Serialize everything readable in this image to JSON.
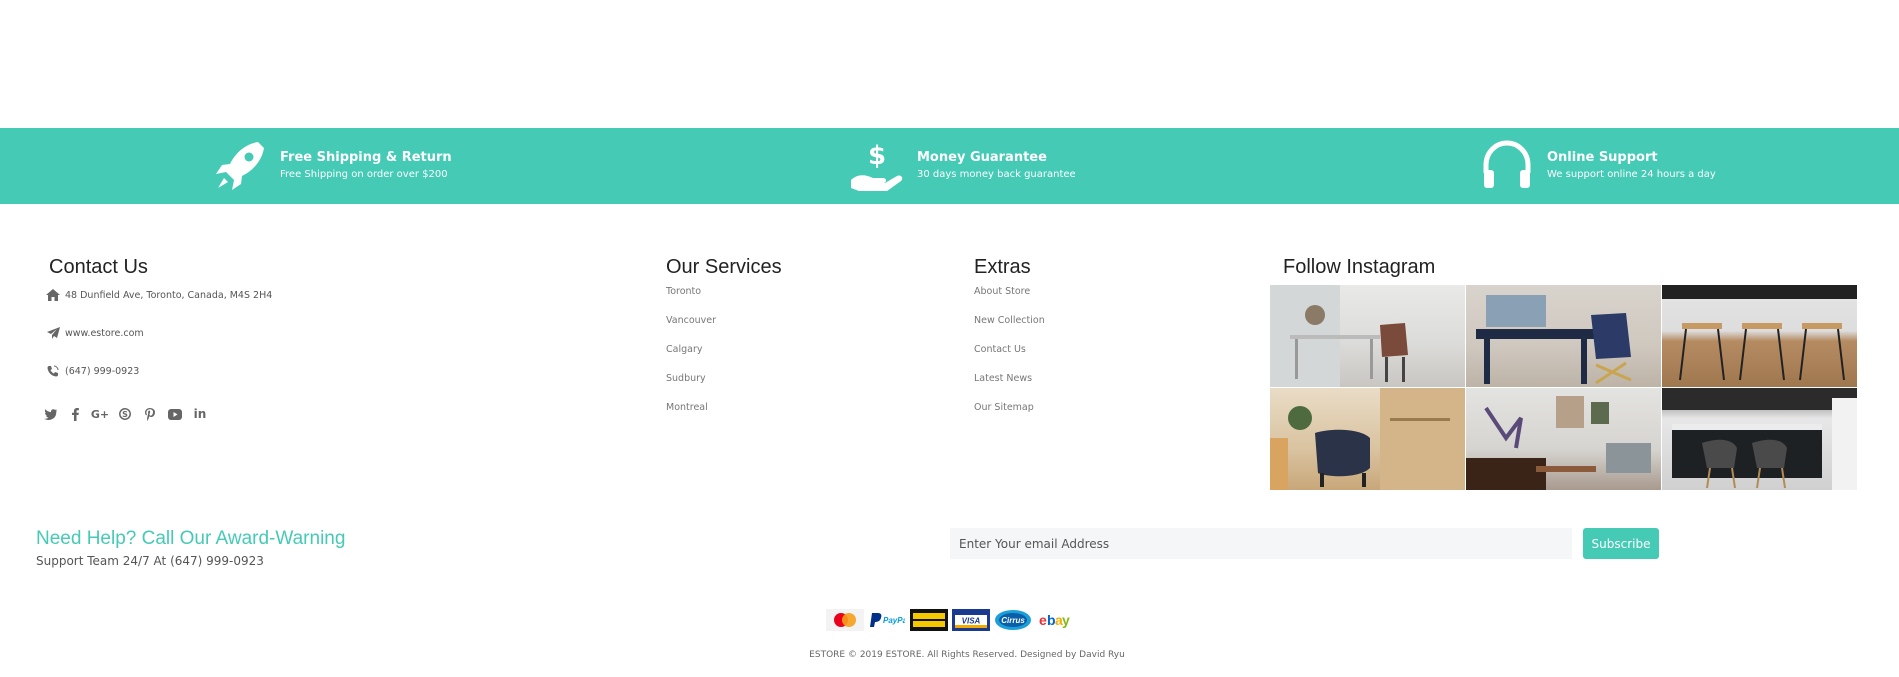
{
  "features": [
    {
      "icon": "rocket-icon",
      "title": "Free Shipping & Return",
      "subtitle": "Free Shipping on order over $200"
    },
    {
      "icon": "money-hand-icon",
      "title": "Money Guarantee",
      "subtitle": "30 days money back guarantee"
    },
    {
      "icon": "headphones-icon",
      "title": "Online Support",
      "subtitle": "We support online 24 hours a day"
    }
  ],
  "contact": {
    "title": "Contact Us",
    "address": "48 Dunfield Ave, Toronto, Canada, M4S 2H4",
    "website": "www.estore.com",
    "phone": "(647) 999-0923",
    "social": [
      "twitter-icon",
      "facebook-icon",
      "google-plus-icon",
      "skype-icon",
      "pinterest-icon",
      "youtube-icon",
      "linkedin-icon"
    ]
  },
  "services": {
    "title": "Our Services",
    "items": [
      "Toronto",
      "Vancouver",
      "Calgary",
      "Sudbury",
      "Montreal"
    ]
  },
  "extras": {
    "title": "Extras",
    "items": [
      "About Store",
      "New Collection",
      "Contact Us",
      "Latest News",
      "Our Sitemap"
    ]
  },
  "instagram": {
    "title": "Follow Instagram"
  },
  "help": {
    "title": "Need Help? Call Our Award-Warning",
    "subtitle": "Support Team 24/7 At (647) 999-0923"
  },
  "newsletter": {
    "placeholder": "Enter Your email Address",
    "button": "Subscribe"
  },
  "payments": [
    "MasterCard",
    "PayPal",
    "WESTERN UNION",
    "VISA",
    "Cirrus",
    "ebay"
  ],
  "copyright": "ESTORE © 2019 ESTORE. All Rights Reserved. Designed by David Ryu",
  "colors": {
    "accent": "#45cab6"
  }
}
